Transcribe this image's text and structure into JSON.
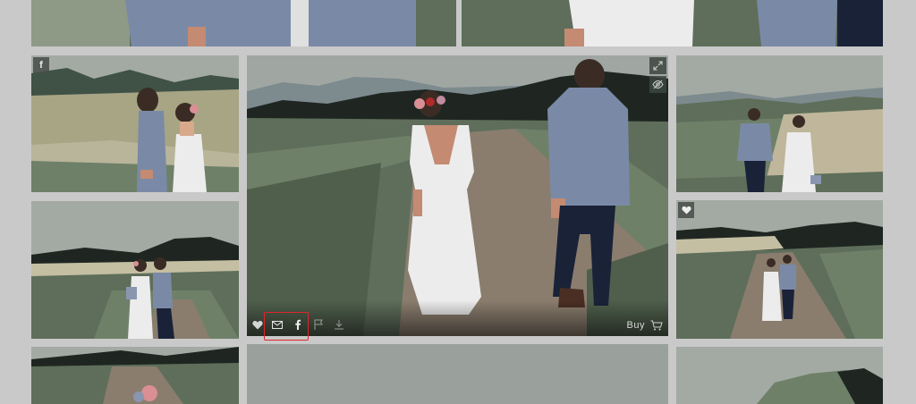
{
  "gallery": {
    "featured": {
      "buy_label": "Buy",
      "actions": {
        "favorite": "heart-icon",
        "email": "envelope-icon",
        "facebook": "facebook-icon",
        "report": "flag-icon",
        "download": "download-icon",
        "cart": "cart-icon",
        "expand": "expand-icon",
        "hide": "eye-off-icon"
      }
    },
    "badges": {
      "facebook_letter": "f"
    }
  },
  "colors": {
    "page_background": "#c9c9c9",
    "highlight": "#e0242c",
    "sky": "#9aa19d",
    "hills_dark": "#1f2622",
    "grass": "#5e6e5a",
    "path": "#8a7d6e",
    "dress": "#ececec",
    "jacket": "#7a8aa6",
    "trousers": "#1a2238"
  }
}
